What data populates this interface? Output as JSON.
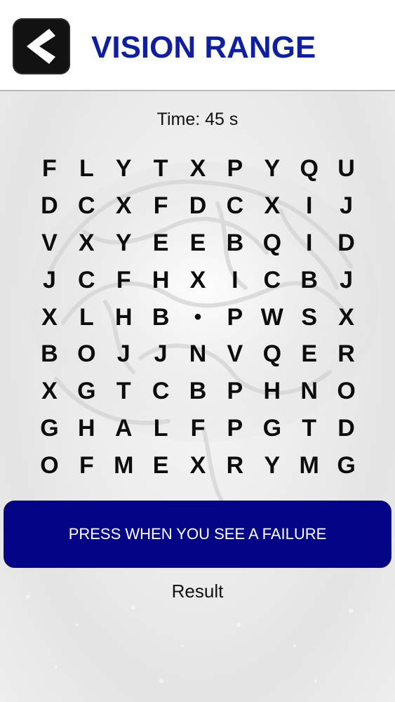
{
  "header": {
    "title": "VISION RANGE",
    "back_icon": "chevron-left-icon"
  },
  "timer": {
    "text": "Time: 45 s"
  },
  "grid": {
    "rows": [
      [
        "F",
        "L",
        "Y",
        "T",
        "X",
        "P",
        "Y",
        "Q",
        "U"
      ],
      [
        "D",
        "C",
        "X",
        "F",
        "D",
        "C",
        "X",
        "I",
        "J"
      ],
      [
        "V",
        "X",
        "Y",
        "E",
        "E",
        "B",
        "Q",
        "I",
        "D"
      ],
      [
        "J",
        "C",
        "F",
        "H",
        "X",
        "I",
        "C",
        "B",
        "J"
      ],
      [
        "X",
        "L",
        "H",
        "B",
        "•",
        "P",
        "W",
        "S",
        "X"
      ],
      [
        "B",
        "O",
        "J",
        "J",
        "N",
        "V",
        "Q",
        "E",
        "R"
      ],
      [
        "X",
        "G",
        "T",
        "C",
        "B",
        "P",
        "H",
        "N",
        "O"
      ],
      [
        "G",
        "H",
        "A",
        "L",
        "F",
        "P",
        "G",
        "T",
        "D"
      ],
      [
        "O",
        "F",
        "M",
        "E",
        "X",
        "R",
        "Y",
        "M",
        "G"
      ]
    ]
  },
  "action": {
    "label": "PRESS WHEN YOU SEE A FAILURE"
  },
  "result": {
    "label": "Result"
  },
  "colors": {
    "title": "#0f1f9e",
    "button_bg": "#030586",
    "button_text": "#ffffff",
    "back_button_bg": "#121212"
  }
}
